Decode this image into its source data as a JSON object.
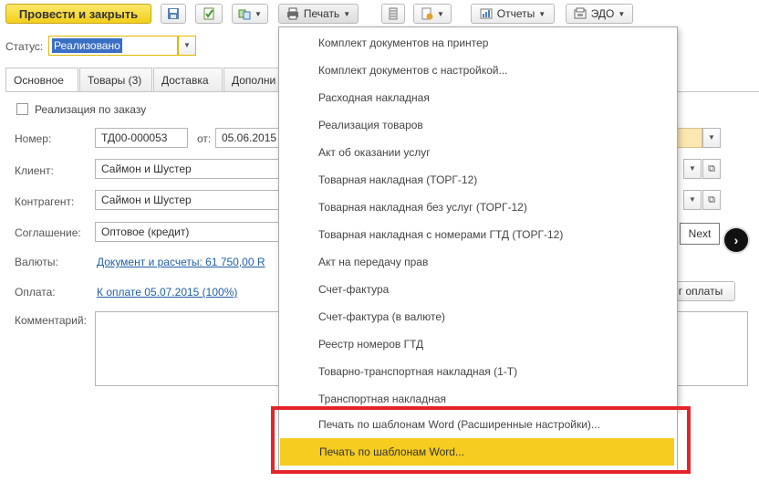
{
  "toolbar": {
    "post_close": "Провести и закрыть",
    "print": "Печать",
    "reports": "Отчеты",
    "edo": "ЭДО"
  },
  "status": {
    "label": "Статус:",
    "value": "Реализовано"
  },
  "tabs": [
    {
      "label": "Основное"
    },
    {
      "label": "Товары (3)"
    },
    {
      "label": "Доставка"
    },
    {
      "label": "Дополни"
    }
  ],
  "form": {
    "by_order": "Реализация по заказу",
    "number_label": "Номер:",
    "number_value": "ТД00-000053",
    "from_label": "от:",
    "date_value": "05.06.2015",
    "client_label": "Клиент:",
    "client_value": "Саймон и Шустер",
    "counterparty_label": "Контрагент:",
    "counterparty_value": "Саймон и Шустер",
    "agreement_label": "Соглашение:",
    "agreement_value": "Оптовое (кредит)",
    "currency_label": "Валюты:",
    "currency_link": "Документ и расчеты: 61 750,00 R",
    "payment_label": "Оплата:",
    "payment_link": "К оплате 05.07.2015 (100%)",
    "payment_button": "г оплаты",
    "comment_label": "Комментарий:"
  },
  "tooltip": {
    "next": "Next"
  },
  "print_menu": {
    "items": [
      "Комплект документов на принтер",
      "Комплект документов с настройкой...",
      "Расходная накладная",
      "Реализация товаров",
      "Акт об оказании услуг",
      "Товарная накладная (ТОРГ-12)",
      "Товарная накладная без услуг (ТОРГ-12)",
      "Товарная накладная с номерами ГТД (ТОРГ-12)",
      "Акт на передачу прав",
      "Счет-фактура",
      "Счет-фактура (в валюте)",
      "Реестр номеров ГТД",
      "Товарно-транспортная накладная (1-Т)",
      "Транспортная накладная",
      "Печать по шаблонам Word (Расширенные настройки)...",
      "Печать по шаблонам Word..."
    ],
    "highlighted_index": 15
  },
  "colors": {
    "accent_yellow": "#f5cc1f",
    "highlight_frame": "#e3242b",
    "link": "#1f5fa8"
  }
}
